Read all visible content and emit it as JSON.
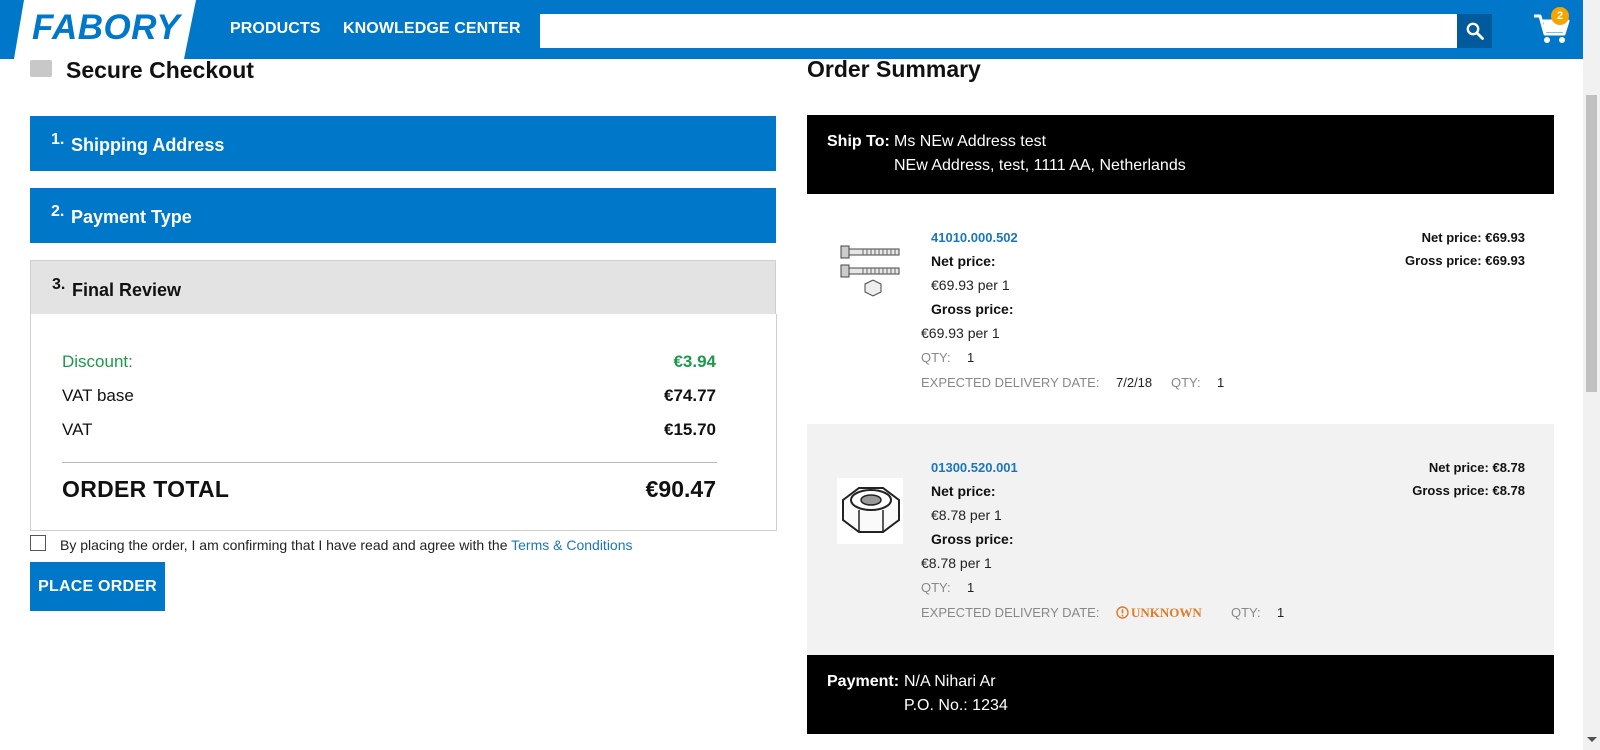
{
  "header": {
    "logo": "FABORY",
    "nav": [
      "PRODUCTS",
      "KNOWLEDGE CENTER"
    ],
    "search": {
      "value": "",
      "placeholder": ""
    },
    "cart_count": "2",
    "brand_color": "#0077c8"
  },
  "checkout": {
    "title": "Secure Checkout",
    "steps": [
      {
        "num": "1.",
        "label": "Shipping Address"
      },
      {
        "num": "2.",
        "label": "Payment Type"
      },
      {
        "num": "3.",
        "label": "Final Review"
      }
    ],
    "review": {
      "discount_label": "Discount:",
      "discount_value": "€3.94",
      "vat_base_label": "VAT base",
      "vat_base_value": "€74.77",
      "vat_label": "VAT",
      "vat_value": "€15.70",
      "total_label": "ORDER TOTAL",
      "total_value": "€90.47"
    },
    "terms_text": "By placing the order, I am confirming that I have read and agree with the ",
    "terms_link": "Terms & Conditions",
    "terms_checked": false,
    "place_order": "PLACE ORDER"
  },
  "summary": {
    "title": "Order Summary",
    "ship_to_label": "Ship To:",
    "ship_to_name": "Ms NEw Address test",
    "ship_to_address": "NEw Address,  test,  1111 AA,  Netherlands",
    "items": [
      {
        "part_number": "41010.000.502",
        "icon": "bolt-and-nut-icon",
        "net_price_label": "Net price:",
        "net_price_value": "€69.93  per 1",
        "gross_price_label": "Gross price:",
        "gross_price_value": "€69.93 per 1",
        "qty_label": "QTY:",
        "qty": "1",
        "delivery_label": "EXPECTED DELIVERY DATE:",
        "delivery_value": "7/2/18",
        "delivery_qty_label": "QTY:",
        "delivery_qty": "1",
        "right_net": "Net price: €69.93",
        "right_gross": "Gross price: €69.93"
      },
      {
        "part_number": "01300.520.001",
        "icon": "hex-nut-icon",
        "net_price_label": "Net price:",
        "net_price_value": "€8.78  per 1",
        "gross_price_label": "Gross price:",
        "gross_price_value": "€8.78 per 1",
        "qty_label": "QTY:",
        "qty": "1",
        "delivery_label": "EXPECTED DELIVERY DATE:",
        "delivery_value": "UNKNOWN",
        "delivery_qty_label": "QTY:",
        "delivery_qty": "1",
        "right_net": "Net price: €8.78",
        "right_gross": "Gross price: €8.78"
      }
    ],
    "payment_label": "Payment:",
    "payment_name": "N/A Nihari Ar",
    "po_number": "P.O. No.: 1234"
  }
}
